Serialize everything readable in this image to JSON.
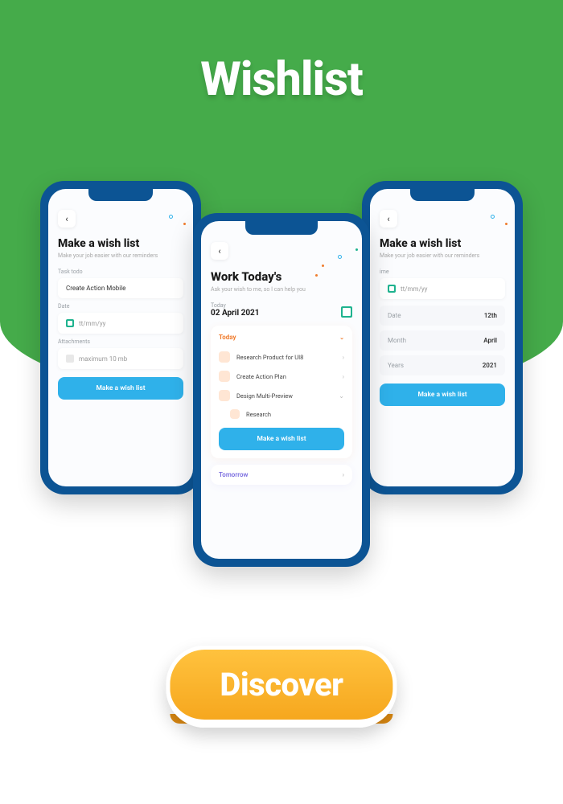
{
  "hero": {
    "title": "Wishlist"
  },
  "discover": {
    "label": "Discover"
  },
  "phone_left": {
    "title": "Make a wish list",
    "subtitle": "Make your job easier with our reminders",
    "task_label": "Task todo",
    "task_value": "Create Action Mobile",
    "date_label": "Date",
    "date_placeholder": "tt/mm/yy",
    "attach_label": "Attachments",
    "attach_placeholder": "maximum 10 mb",
    "cta": "Make a wish list"
  },
  "phone_center": {
    "title": "Work Today's",
    "subtitle": "Ask your wish to me, so I can help you",
    "today_label": "Today",
    "today_date": "02 April 2021",
    "group_today": "Today",
    "tasks": [
      "Research Product for UI8",
      "Create Action Plan",
      "Design Multi-Preview",
      "Research"
    ],
    "cta": "Make a wish list",
    "group_tomorrow": "Tomorrow"
  },
  "phone_right": {
    "title": "Make a wish list",
    "subtitle": "Make your job easier with our reminders",
    "time_label": "ime",
    "time_placeholder": "tt/mm/yy",
    "rows": [
      {
        "k": "Date",
        "v": "12th"
      },
      {
        "k": "Month",
        "v": "April"
      },
      {
        "k": "Years",
        "v": "2021"
      }
    ],
    "cta": "Make a wish list"
  }
}
